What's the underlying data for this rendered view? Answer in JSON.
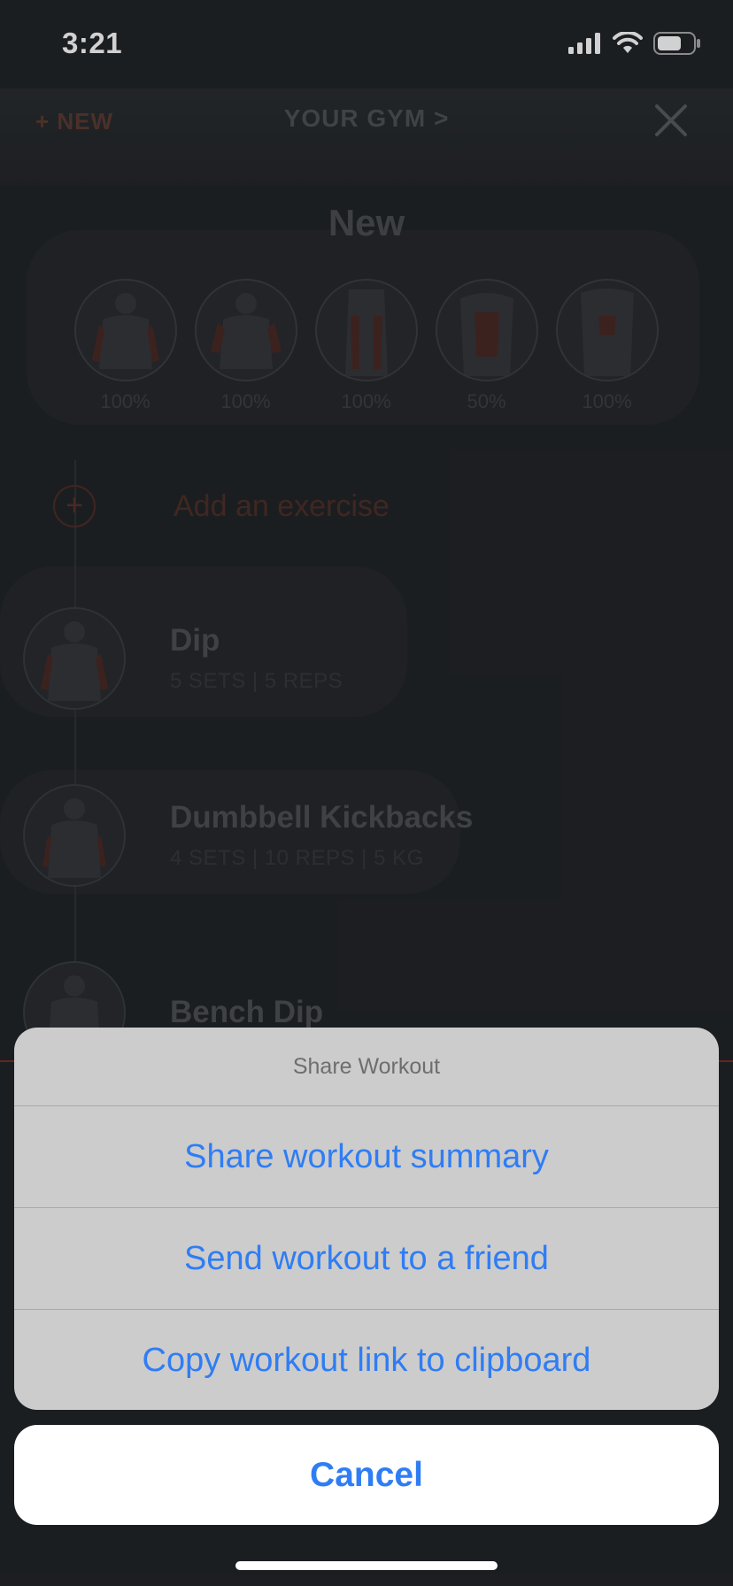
{
  "status_bar": {
    "time": "3:21"
  },
  "topbar": {
    "new_label": "+ NEW",
    "gym_label": "YOUR GYM >"
  },
  "workout": {
    "title": "New",
    "muscles": [
      {
        "percent": "100%"
      },
      {
        "percent": "100%"
      },
      {
        "percent": "100%"
      },
      {
        "percent": "50%"
      },
      {
        "percent": "100%"
      }
    ],
    "add_exercise": "Add an exercise",
    "exercises": [
      {
        "name": "Dip",
        "sets": "5 SETS",
        "reps": "5 REPS",
        "weight": ""
      },
      {
        "name": "Dumbbell Kickbacks",
        "sets": "4 SETS",
        "reps": "10 REPS",
        "weight": "5 KG"
      },
      {
        "name": "Bench Dip",
        "sets": "",
        "reps": "",
        "weight": ""
      }
    ]
  },
  "action_sheet": {
    "title": "Share Workout",
    "options": [
      {
        "label": "Share workout summary"
      },
      {
        "label": "Send workout to a friend"
      },
      {
        "label": "Copy workout link to clipboard"
      }
    ],
    "cancel_label": "Cancel"
  },
  "colors": {
    "accent_blue": "#2f7df4",
    "sheet_bg": "#cccccc",
    "app_bg": "#222529",
    "brand_red": "#7a2e25"
  }
}
